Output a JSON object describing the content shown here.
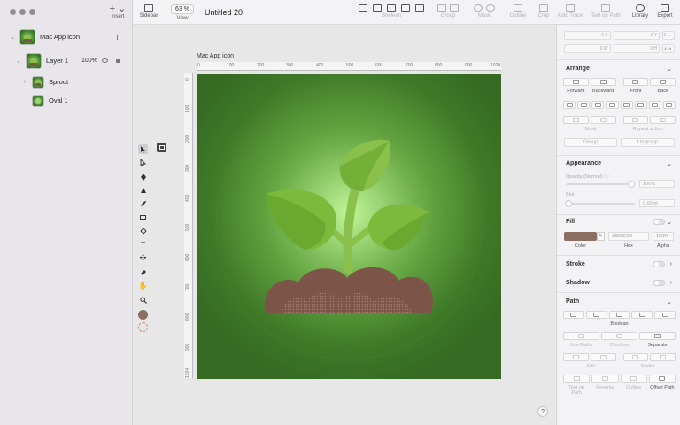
{
  "window": {
    "document_title": "Untitled 20"
  },
  "toolbar": {
    "sidebar_label": "Sidebar",
    "zoom_value": "63 %",
    "view_label": "View",
    "boolean_label": "Boolean",
    "group_label": "Group",
    "mask_label": "Mask",
    "outline_label": "Outline",
    "crop_label": "Crop",
    "auto_trace_label": "Auto Trace",
    "text_on_path_label": "Text on Path",
    "library_label": "Library",
    "export_label": "Export",
    "insert_label": "Insert"
  },
  "layers": [
    {
      "name": "Mac App icon",
      "icon": "artboard-thumbnail",
      "expanded": true
    },
    {
      "name": "Layer 1",
      "opacity": "100%",
      "icon": "layer-thumbnail",
      "expanded": true
    },
    {
      "name": "Sprout",
      "icon": "group-thumbnail",
      "expanded": false
    },
    {
      "name": "Oval 1",
      "icon": "oval-thumbnail"
    }
  ],
  "canvas": {
    "artboard_title": "Mac App icon",
    "hruler_ticks": [
      "0",
      "100",
      "200",
      "300",
      "400",
      "500",
      "600",
      "700",
      "800",
      "900",
      "1024"
    ],
    "vruler_ticks": [
      "0",
      "100",
      "200",
      "300",
      "400",
      "500",
      "600",
      "700",
      "800",
      "900",
      "1024"
    ],
    "help_label": "?"
  },
  "inspector": {
    "dims": {
      "x_label": "X",
      "y_label": "Y",
      "w_label": "W",
      "h_label": "H",
      "a_label": "A",
      "x_value": "0",
      "y_value": "0",
      "w_value": "0",
      "h_value": "0",
      "a_value": "0"
    },
    "arrange": {
      "title": "Arrange",
      "order_labels": [
        "Forward",
        "Backward",
        "Front",
        "Back"
      ],
      "mask_label": "Mask",
      "repeat_label": "Repeat action",
      "group_label": "Group",
      "ungroup_label": "Ungroup"
    },
    "appearance": {
      "title": "Appearance",
      "opacity_label": "Opacity (Normal)",
      "opacity_value": "100%",
      "blur_label": "Blur",
      "blur_value": "0.00 pt"
    },
    "fill": {
      "title": "Fill",
      "color_hex": "#8D6E63",
      "hex_placeholder": "#8D6E63",
      "alpha_value": "100%",
      "color_label": "Color",
      "hex_label": "Hex",
      "alpha_label": "Alpha"
    },
    "stroke_title": "Stroke",
    "shadow_title": "Shadow",
    "path": {
      "title": "Path",
      "boolean_label": "Boolean",
      "join_label": "Join Paths",
      "combine_label": "Combine",
      "separate_label": "Separate",
      "edit_label": "Edit",
      "nodes_label": "Nodes",
      "text_on_path_label": "Text on Path",
      "reverse_label": "Reverse",
      "outline_label": "Outline",
      "offset_label": "Offset Path"
    }
  },
  "colors": {
    "background_green": "#3f7a28",
    "glow_green": "#b8f08a",
    "leaf_green": "#7dba3c",
    "stem_green": "#8cc04c",
    "soil_brown": "#7c5548",
    "soil_light": "#9a7366",
    "swatch_fill": "#8D6E63"
  }
}
